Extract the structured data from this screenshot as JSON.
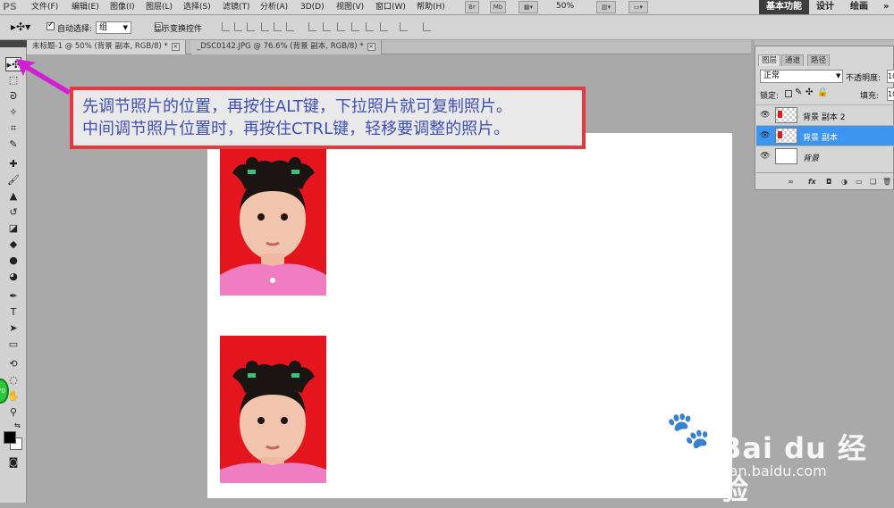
{
  "app": {
    "logo": "PS"
  },
  "menubar": {
    "items": [
      "文件(F)",
      "编辑(E)",
      "图像(I)",
      "图层(L)",
      "选择(S)",
      "滤镜(T)",
      "分析(A)",
      "3D(D)",
      "视图(V)",
      "窗口(W)",
      "帮助(H)"
    ],
    "br_label": "Br",
    "mb_label": "Mb",
    "zoom": "50%",
    "workspaces": [
      "基本功能",
      "设计",
      "绘画"
    ],
    "workspace_more": "»"
  },
  "options": {
    "auto_select_label": "自动选择:",
    "auto_select_checked": true,
    "auto_select_target": "组",
    "show_transform_label": "显示变换控件"
  },
  "tabs": [
    {
      "label": "未标题-1 @ 50% (背景 副本, RGB/8) *",
      "active": true
    },
    {
      "label": "_DSC0142.JPG @ 76.6% (背景 副本, RGB/8) *",
      "active": false
    }
  ],
  "annotation": {
    "line1": "先调节照片的位置，再按住ALT键，下拉照片就可复制照片。",
    "line2": "中间调节照片位置时，再按住CTRL键，轻移要调整的照片。",
    "border_color": "#e43a3f",
    "text_color": "#3f4fb7"
  },
  "layers_panel": {
    "tabs": [
      "图层",
      "通道",
      "路径"
    ],
    "blend_mode": "正常",
    "opacity_label": "不透明度:",
    "opacity_value": "10",
    "lock_label": "锁定:",
    "fill_label": "填充:",
    "fill_value": "10",
    "layers": [
      {
        "name": "背景 副本 2",
        "selected": false
      },
      {
        "name": "背景 副本",
        "selected": true
      },
      {
        "name": "背景",
        "selected": false
      }
    ],
    "selection_color": "#3d95f0"
  },
  "watermark": {
    "brand": "Bai du 经验",
    "url": "jingyan.baidu.com"
  }
}
